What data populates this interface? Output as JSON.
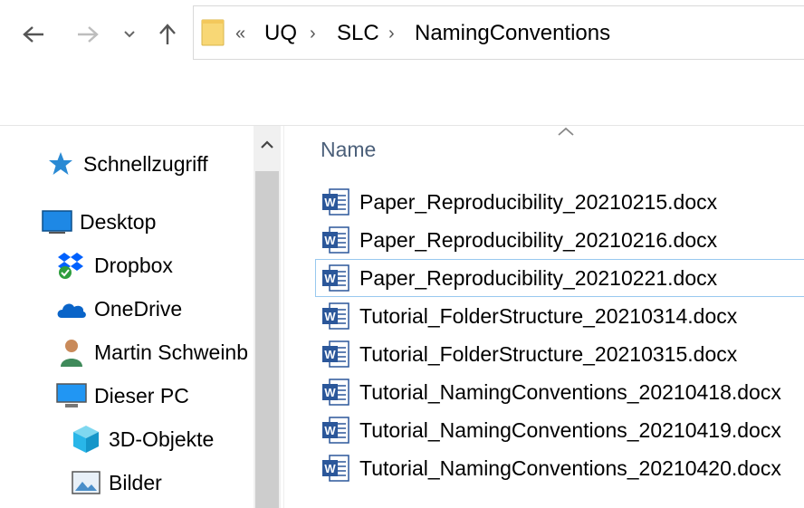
{
  "navigation": {
    "back_glyph": "←",
    "forward_glyph": "→",
    "recent_glyph": "⌄",
    "up_glyph": "↑"
  },
  "address_bar": {
    "overflow_glyph": "«",
    "separator": "›",
    "breadcrumbs": [
      "UQ",
      "SLC",
      "NamingConventions"
    ]
  },
  "sidebar": {
    "items": [
      {
        "label": "Schnellzugriff",
        "icon": "star-icon"
      },
      {
        "label": "Desktop",
        "icon": "desktop-icon"
      },
      {
        "label": "Dropbox",
        "icon": "dropbox-icon"
      },
      {
        "label": "OneDrive",
        "icon": "onedrive-icon"
      },
      {
        "label": "Martin Schweinb",
        "icon": "user-icon"
      },
      {
        "label": "Dieser PC",
        "icon": "pc-icon"
      },
      {
        "label": "3D-Objekte",
        "icon": "cube-icon"
      },
      {
        "label": "Bilder",
        "icon": "pictures-icon"
      }
    ]
  },
  "file_list": {
    "column_header": "Name",
    "files": [
      "Paper_Reproducibility_20210215.docx",
      "Paper_Reproducibility_20210216.docx",
      "Paper_Reproducibility_20210221.docx",
      "Tutorial_FolderStructure_20210314.docx",
      "Tutorial_FolderStructure_20210315.docx",
      "Tutorial_NamingConventions_20210418.docx",
      "Tutorial_NamingConventions_20210419.docx",
      "Tutorial_NamingConventions_20210420.docx"
    ],
    "file_icon": "word-document-icon",
    "focused_index": 2
  },
  "colors": {
    "header_text": "#4c607a",
    "focus_border": "#99c9ef",
    "word_blue": "#2b579a",
    "folder_yellow": "#f8d775"
  }
}
